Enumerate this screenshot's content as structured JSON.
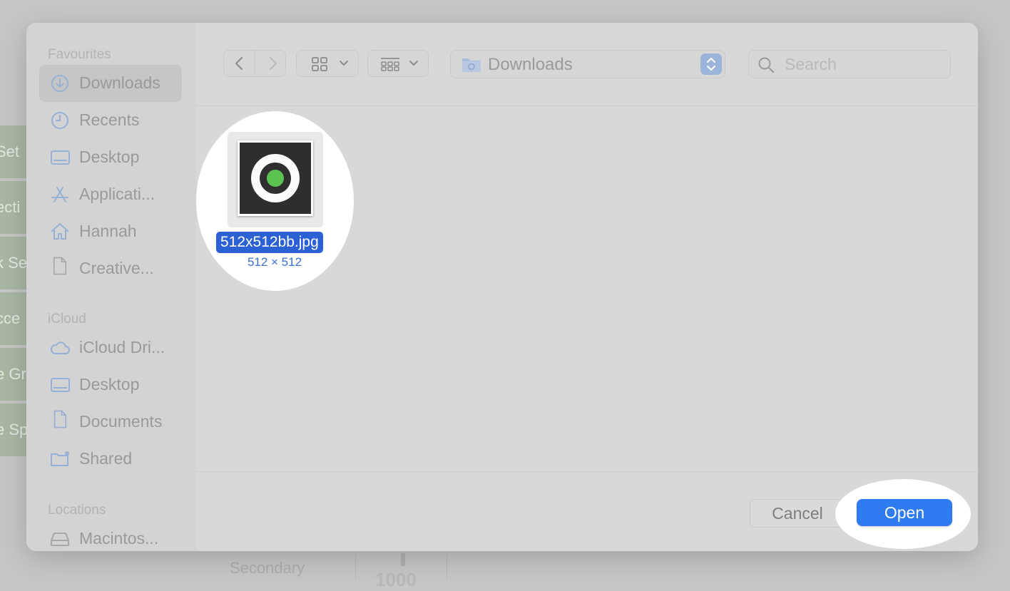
{
  "background_app": {
    "rows": [
      "Set",
      "ecti",
      "k Se",
      "cce",
      "e Gr",
      "e Sp"
    ],
    "bottom_label": "Secondary",
    "bottom_number": "1000"
  },
  "sidebar": {
    "favourites_title": "Favourites",
    "favourites": [
      {
        "label": "Downloads",
        "icon": "download-circle-icon"
      },
      {
        "label": "Recents",
        "icon": "clock-icon"
      },
      {
        "label": "Desktop",
        "icon": "desktop-icon"
      },
      {
        "label": "Applicati...",
        "icon": "applications-icon"
      },
      {
        "label": "Hannah",
        "icon": "home-icon"
      },
      {
        "label": "Creative...",
        "icon": "document-icon"
      }
    ],
    "icloud_title": "iCloud",
    "icloud": [
      {
        "label": "iCloud Dri...",
        "icon": "cloud-icon"
      },
      {
        "label": "Desktop",
        "icon": "desktop-icon"
      },
      {
        "label": "Documents",
        "icon": "document-icon"
      },
      {
        "label": "Shared",
        "icon": "shared-folder-icon"
      }
    ],
    "locations_title": "Locations",
    "locations": [
      {
        "label": "Macintos...",
        "icon": "disk-icon"
      }
    ]
  },
  "toolbar": {
    "back_icon": "chevron-left-icon",
    "forward_icon": "chevron-right-icon",
    "view_icon": "icon-grid-view-icon",
    "group_icon": "group-view-icon",
    "path_folder": "Downloads",
    "search_placeholder": "Search"
  },
  "files": [
    {
      "name": "512x512bb.jpg",
      "dimensions": "512 × 512",
      "selected": true
    }
  ],
  "footer": {
    "cancel_label": "Cancel",
    "open_label": "Open"
  },
  "colors": {
    "selection_blue": "#2c61d6",
    "open_button_blue": "#2f7bf0",
    "thumbnail_green": "#5cc250"
  }
}
